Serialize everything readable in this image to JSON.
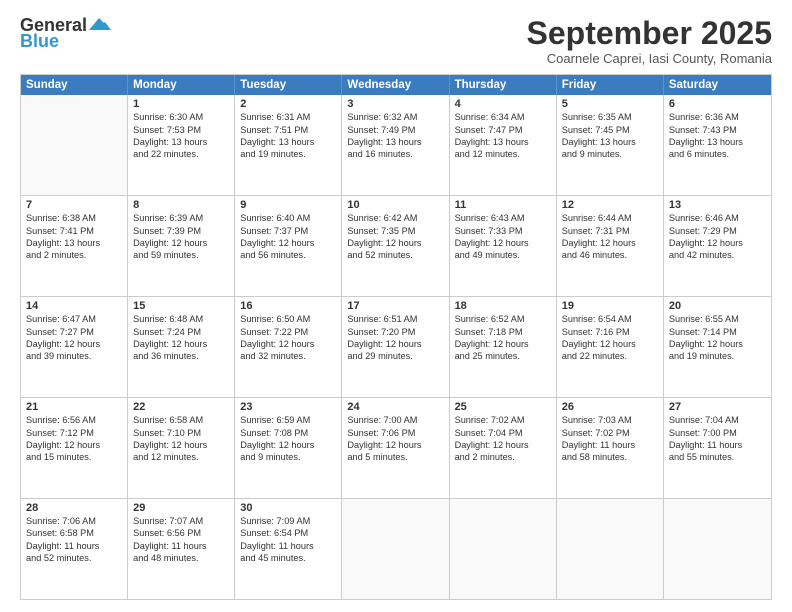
{
  "header": {
    "logo_general": "General",
    "logo_blue": "Blue",
    "month_title": "September 2025",
    "location": "Coarnele Caprei, Iasi County, Romania"
  },
  "days_of_week": [
    "Sunday",
    "Monday",
    "Tuesday",
    "Wednesday",
    "Thursday",
    "Friday",
    "Saturday"
  ],
  "weeks": [
    [
      {
        "day": "",
        "empty": true
      },
      {
        "day": "1",
        "lines": [
          "Sunrise: 6:30 AM",
          "Sunset: 7:53 PM",
          "Daylight: 13 hours",
          "and 22 minutes."
        ]
      },
      {
        "day": "2",
        "lines": [
          "Sunrise: 6:31 AM",
          "Sunset: 7:51 PM",
          "Daylight: 13 hours",
          "and 19 minutes."
        ]
      },
      {
        "day": "3",
        "lines": [
          "Sunrise: 6:32 AM",
          "Sunset: 7:49 PM",
          "Daylight: 13 hours",
          "and 16 minutes."
        ]
      },
      {
        "day": "4",
        "lines": [
          "Sunrise: 6:34 AM",
          "Sunset: 7:47 PM",
          "Daylight: 13 hours",
          "and 12 minutes."
        ]
      },
      {
        "day": "5",
        "lines": [
          "Sunrise: 6:35 AM",
          "Sunset: 7:45 PM",
          "Daylight: 13 hours",
          "and 9 minutes."
        ]
      },
      {
        "day": "6",
        "lines": [
          "Sunrise: 6:36 AM",
          "Sunset: 7:43 PM",
          "Daylight: 13 hours",
          "and 6 minutes."
        ]
      }
    ],
    [
      {
        "day": "7",
        "lines": [
          "Sunrise: 6:38 AM",
          "Sunset: 7:41 PM",
          "Daylight: 13 hours",
          "and 2 minutes."
        ]
      },
      {
        "day": "8",
        "lines": [
          "Sunrise: 6:39 AM",
          "Sunset: 7:39 PM",
          "Daylight: 12 hours",
          "and 59 minutes."
        ]
      },
      {
        "day": "9",
        "lines": [
          "Sunrise: 6:40 AM",
          "Sunset: 7:37 PM",
          "Daylight: 12 hours",
          "and 56 minutes."
        ]
      },
      {
        "day": "10",
        "lines": [
          "Sunrise: 6:42 AM",
          "Sunset: 7:35 PM",
          "Daylight: 12 hours",
          "and 52 minutes."
        ]
      },
      {
        "day": "11",
        "lines": [
          "Sunrise: 6:43 AM",
          "Sunset: 7:33 PM",
          "Daylight: 12 hours",
          "and 49 minutes."
        ]
      },
      {
        "day": "12",
        "lines": [
          "Sunrise: 6:44 AM",
          "Sunset: 7:31 PM",
          "Daylight: 12 hours",
          "and 46 minutes."
        ]
      },
      {
        "day": "13",
        "lines": [
          "Sunrise: 6:46 AM",
          "Sunset: 7:29 PM",
          "Daylight: 12 hours",
          "and 42 minutes."
        ]
      }
    ],
    [
      {
        "day": "14",
        "lines": [
          "Sunrise: 6:47 AM",
          "Sunset: 7:27 PM",
          "Daylight: 12 hours",
          "and 39 minutes."
        ]
      },
      {
        "day": "15",
        "lines": [
          "Sunrise: 6:48 AM",
          "Sunset: 7:24 PM",
          "Daylight: 12 hours",
          "and 36 minutes."
        ]
      },
      {
        "day": "16",
        "lines": [
          "Sunrise: 6:50 AM",
          "Sunset: 7:22 PM",
          "Daylight: 12 hours",
          "and 32 minutes."
        ]
      },
      {
        "day": "17",
        "lines": [
          "Sunrise: 6:51 AM",
          "Sunset: 7:20 PM",
          "Daylight: 12 hours",
          "and 29 minutes."
        ]
      },
      {
        "day": "18",
        "lines": [
          "Sunrise: 6:52 AM",
          "Sunset: 7:18 PM",
          "Daylight: 12 hours",
          "and 25 minutes."
        ]
      },
      {
        "day": "19",
        "lines": [
          "Sunrise: 6:54 AM",
          "Sunset: 7:16 PM",
          "Daylight: 12 hours",
          "and 22 minutes."
        ]
      },
      {
        "day": "20",
        "lines": [
          "Sunrise: 6:55 AM",
          "Sunset: 7:14 PM",
          "Daylight: 12 hours",
          "and 19 minutes."
        ]
      }
    ],
    [
      {
        "day": "21",
        "lines": [
          "Sunrise: 6:56 AM",
          "Sunset: 7:12 PM",
          "Daylight: 12 hours",
          "and 15 minutes."
        ]
      },
      {
        "day": "22",
        "lines": [
          "Sunrise: 6:58 AM",
          "Sunset: 7:10 PM",
          "Daylight: 12 hours",
          "and 12 minutes."
        ]
      },
      {
        "day": "23",
        "lines": [
          "Sunrise: 6:59 AM",
          "Sunset: 7:08 PM",
          "Daylight: 12 hours",
          "and 9 minutes."
        ]
      },
      {
        "day": "24",
        "lines": [
          "Sunrise: 7:00 AM",
          "Sunset: 7:06 PM",
          "Daylight: 12 hours",
          "and 5 minutes."
        ]
      },
      {
        "day": "25",
        "lines": [
          "Sunrise: 7:02 AM",
          "Sunset: 7:04 PM",
          "Daylight: 12 hours",
          "and 2 minutes."
        ]
      },
      {
        "day": "26",
        "lines": [
          "Sunrise: 7:03 AM",
          "Sunset: 7:02 PM",
          "Daylight: 11 hours",
          "and 58 minutes."
        ]
      },
      {
        "day": "27",
        "lines": [
          "Sunrise: 7:04 AM",
          "Sunset: 7:00 PM",
          "Daylight: 11 hours",
          "and 55 minutes."
        ]
      }
    ],
    [
      {
        "day": "28",
        "lines": [
          "Sunrise: 7:06 AM",
          "Sunset: 6:58 PM",
          "Daylight: 11 hours",
          "and 52 minutes."
        ]
      },
      {
        "day": "29",
        "lines": [
          "Sunrise: 7:07 AM",
          "Sunset: 6:56 PM",
          "Daylight: 11 hours",
          "and 48 minutes."
        ]
      },
      {
        "day": "30",
        "lines": [
          "Sunrise: 7:09 AM",
          "Sunset: 6:54 PM",
          "Daylight: 11 hours",
          "and 45 minutes."
        ]
      },
      {
        "day": "",
        "empty": true
      },
      {
        "day": "",
        "empty": true
      },
      {
        "day": "",
        "empty": true
      },
      {
        "day": "",
        "empty": true
      }
    ]
  ]
}
